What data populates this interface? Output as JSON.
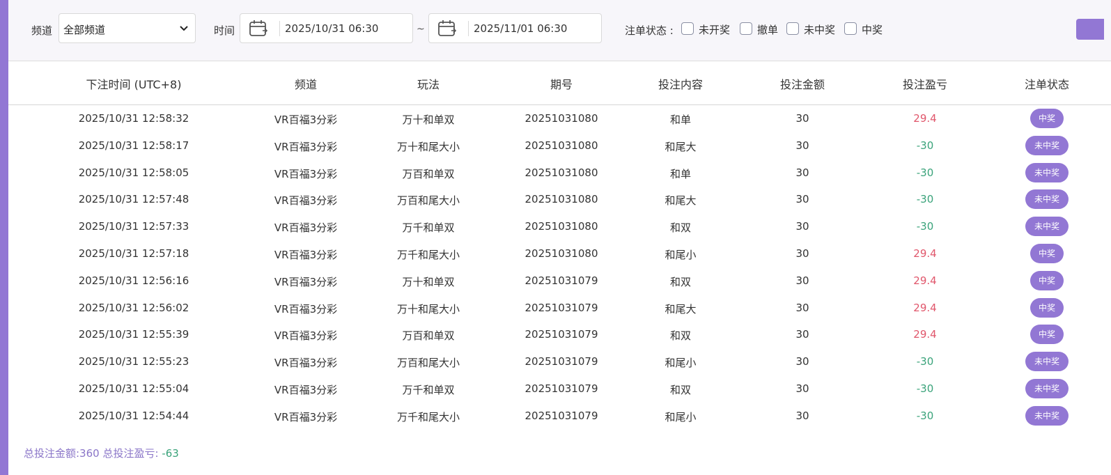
{
  "filters": {
    "channel_label": "频道",
    "channel_value": "全部频道",
    "time_label": "时间",
    "start_time": "2025/10/31 06:30",
    "range_sep": "~",
    "end_time": "2025/11/01 06:30",
    "status_label": "注单状态 :",
    "statuses": [
      "未开奖",
      "撤单",
      "未中奖",
      "中奖"
    ]
  },
  "table": {
    "headers": [
      "下注时间 (UTC+8)",
      "频道",
      "玩法",
      "期号",
      "投注内容",
      "投注金额",
      "投注盈亏",
      "注单状态"
    ],
    "rows": [
      {
        "time": "2025/10/31 12:58:32",
        "channel": "VR百福3分彩",
        "play": "万十和单双",
        "issue": "20251031080",
        "content": "和单",
        "amount": "30",
        "pnl": "29.4",
        "status": "中奖"
      },
      {
        "time": "2025/10/31 12:58:17",
        "channel": "VR百福3分彩",
        "play": "万十和尾大小",
        "issue": "20251031080",
        "content": "和尾大",
        "amount": "30",
        "pnl": "-30",
        "status": "未中奖"
      },
      {
        "time": "2025/10/31 12:58:05",
        "channel": "VR百福3分彩",
        "play": "万百和单双",
        "issue": "20251031080",
        "content": "和单",
        "amount": "30",
        "pnl": "-30",
        "status": "未中奖"
      },
      {
        "time": "2025/10/31 12:57:48",
        "channel": "VR百福3分彩",
        "play": "万百和尾大小",
        "issue": "20251031080",
        "content": "和尾大",
        "amount": "30",
        "pnl": "-30",
        "status": "未中奖"
      },
      {
        "time": "2025/10/31 12:57:33",
        "channel": "VR百福3分彩",
        "play": "万千和单双",
        "issue": "20251031080",
        "content": "和双",
        "amount": "30",
        "pnl": "-30",
        "status": "未中奖"
      },
      {
        "time": "2025/10/31 12:57:18",
        "channel": "VR百福3分彩",
        "play": "万千和尾大小",
        "issue": "20251031080",
        "content": "和尾小",
        "amount": "30",
        "pnl": "29.4",
        "status": "中奖"
      },
      {
        "time": "2025/10/31 12:56:16",
        "channel": "VR百福3分彩",
        "play": "万十和单双",
        "issue": "20251031079",
        "content": "和双",
        "amount": "30",
        "pnl": "29.4",
        "status": "中奖"
      },
      {
        "time": "2025/10/31 12:56:02",
        "channel": "VR百福3分彩",
        "play": "万十和尾大小",
        "issue": "20251031079",
        "content": "和尾大",
        "amount": "30",
        "pnl": "29.4",
        "status": "中奖"
      },
      {
        "time": "2025/10/31 12:55:39",
        "channel": "VR百福3分彩",
        "play": "万百和单双",
        "issue": "20251031079",
        "content": "和双",
        "amount": "30",
        "pnl": "29.4",
        "status": "中奖"
      },
      {
        "time": "2025/10/31 12:55:23",
        "channel": "VR百福3分彩",
        "play": "万百和尾大小",
        "issue": "20251031079",
        "content": "和尾小",
        "amount": "30",
        "pnl": "-30",
        "status": "未中奖"
      },
      {
        "time": "2025/10/31 12:55:04",
        "channel": "VR百福3分彩",
        "play": "万千和单双",
        "issue": "20251031079",
        "content": "和双",
        "amount": "30",
        "pnl": "-30",
        "status": "未中奖"
      },
      {
        "time": "2025/10/31 12:54:44",
        "channel": "VR百福3分彩",
        "play": "万千和尾大小",
        "issue": "20251031079",
        "content": "和尾小",
        "amount": "30",
        "pnl": "-30",
        "status": "未中奖"
      }
    ]
  },
  "summary": {
    "total_amount_text": "总投注金额:360",
    "total_pnl_label": "总投注盈亏:",
    "total_pnl": "-63"
  },
  "colors": {
    "accent": "#9277d4",
    "win": "#e0566b",
    "loss": "#3aa37a"
  }
}
